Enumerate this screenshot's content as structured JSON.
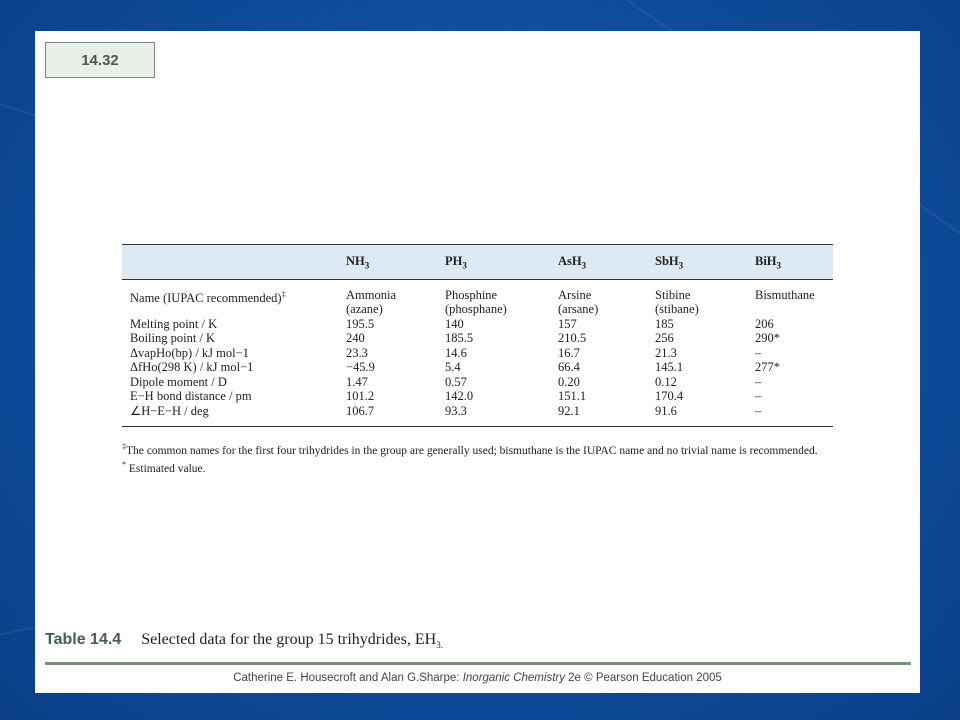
{
  "badge": "14.32",
  "table": {
    "headers": [
      "",
      "NH",
      "PH",
      "AsH",
      "SbH",
      "BiH"
    ],
    "header_sub": "3",
    "name_row": {
      "label": "Name (IUPAC recommended)",
      "label_mark": "‡",
      "line1": [
        "Ammonia",
        "Phosphine",
        "Arsine",
        "Stibine",
        "Bismuthane"
      ],
      "line2": [
        "(azane)",
        "(phosphane)",
        "(arsane)",
        "(stibane)",
        ""
      ]
    },
    "rows": [
      {
        "label": "Melting point / K",
        "values": [
          "195.5",
          "140",
          "157",
          "185",
          "206"
        ]
      },
      {
        "label": "Boiling point / K",
        "values": [
          "240",
          "185.5",
          "210.5",
          "256",
          "290*"
        ]
      },
      {
        "label": "ΔvapHo(bp) / kJ mol−1",
        "values": [
          "23.3",
          "14.6",
          "16.7",
          "21.3",
          "–"
        ]
      },
      {
        "label": "ΔfHo(298 K) / kJ mol−1",
        "values": [
          "−45.9",
          "5.4",
          "66.4",
          "145.1",
          "277*"
        ]
      },
      {
        "label": "Dipole moment / D",
        "values": [
          "1.47",
          "0.57",
          "0.20",
          "0.12",
          "–"
        ]
      },
      {
        "label": "E−H bond distance / pm",
        "values": [
          "101.2",
          "142.0",
          "151.1",
          "170.4",
          "–"
        ]
      },
      {
        "label": "∠H−E−H / deg",
        "values": [
          "106.7",
          "93.3",
          "92.1",
          "91.6",
          "–"
        ]
      }
    ]
  },
  "footnotes": {
    "note1_mark": "‡",
    "note1": "The common names for the first four trihydrides in the group are generally used; bismuthane is the IUPAC name and no trivial name is recommended.",
    "note2_mark": "*",
    "note2": "Estimated value."
  },
  "caption": {
    "label": "Table 14.4",
    "text": "Selected data for the group 15 trihydrides, EH",
    "text_sub": "3."
  },
  "credit": {
    "authors": "Catherine E. Housecroft and Alan G.Sharpe: ",
    "book": "Inorganic Chemistry",
    "rest": " 2e © Pearson Education 2005"
  }
}
